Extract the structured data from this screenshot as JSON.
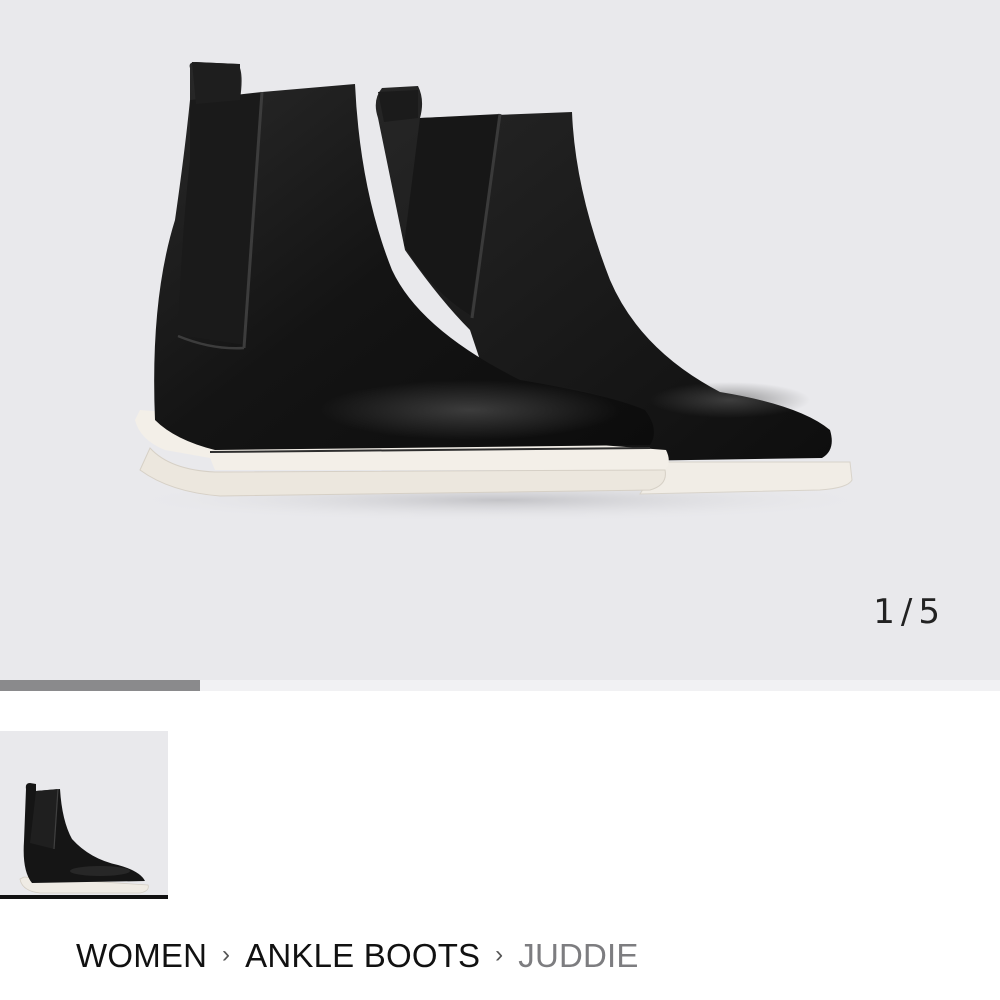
{
  "gallery": {
    "image_alt": "Black leather chelsea ankle boots with white sole",
    "current_index": "1",
    "separator": "/",
    "total": "5",
    "progress_fraction": 0.2
  },
  "thumbnails": [
    {
      "alt": "Black leather chelsea ankle boot side view",
      "selected": true
    }
  ],
  "breadcrumb": [
    {
      "label": "WOMEN"
    },
    {
      "label": "ANKLE BOOTS"
    },
    {
      "label": "JUDDIE"
    }
  ],
  "icons": {
    "breadcrumb_separator": "chevron-right-icon"
  },
  "colors": {
    "gallery_bg": "#e9e9ec",
    "progress_fill": "#8a8a8c",
    "current_crumb": "#7d7d80"
  }
}
